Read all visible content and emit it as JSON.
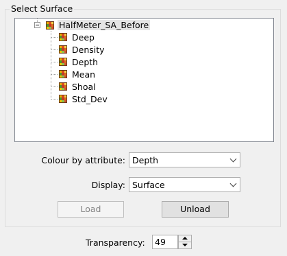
{
  "group": {
    "title": "Select Surface"
  },
  "tree": {
    "root": {
      "label": "HalfMeter_SA_Before",
      "icon": "surface-grid-icon"
    },
    "children": [
      {
        "label": "Deep",
        "icon": "surface-grid-icon"
      },
      {
        "label": "Density",
        "icon": "surface-grid-icon"
      },
      {
        "label": "Depth",
        "icon": "surface-grid-icon"
      },
      {
        "label": "Mean",
        "icon": "surface-grid-icon"
      },
      {
        "label": "Shoal",
        "icon": "surface-grid-icon"
      },
      {
        "label": "Std_Dev",
        "icon": "surface-grid-icon"
      }
    ]
  },
  "colour_by": {
    "label": "Colour by attribute:",
    "value": "Depth"
  },
  "display": {
    "label": "Display:",
    "value": "Surface"
  },
  "buttons": {
    "load": "Load",
    "unload": "Unload"
  },
  "transparency": {
    "label": "Transparency:",
    "value": "49"
  }
}
